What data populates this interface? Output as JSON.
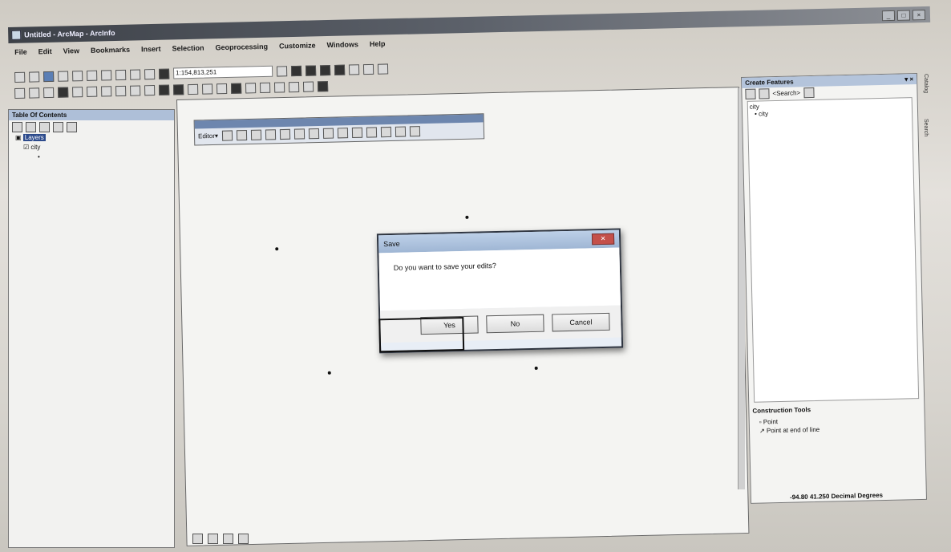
{
  "window": {
    "title": "Untitled - ArcMap - ArcInfo",
    "controls": [
      "_",
      "□",
      "×"
    ]
  },
  "menu": {
    "items": [
      "File",
      "Edit",
      "View",
      "Bookmarks",
      "Insert",
      "Selection",
      "Geoprocessing",
      "Customize",
      "Windows",
      "Help"
    ]
  },
  "toolbar": {
    "scale_value": "1:154,813,251"
  },
  "toc": {
    "title": "Table Of Contents",
    "layers_label": "Layers",
    "layer_item": "city"
  },
  "editor_toolbar": {
    "title": "Editor",
    "menu_label": "Editor▾"
  },
  "dialog": {
    "title": "Save",
    "message": "Do you want to save your edits?",
    "yes_label": "Yes",
    "no_label": "No",
    "cancel_label": "Cancel"
  },
  "create_features": {
    "title": "Create Features",
    "search_label": "<Search>",
    "template_group": "city",
    "template_item": "city"
  },
  "construction_tools": {
    "title": "Construction Tools",
    "items": [
      "Point",
      "Point at end of line"
    ]
  },
  "status": {
    "coords": "-94.80 41.250 Decimal Degrees"
  },
  "side_tabs": {
    "catalog": "Catalog",
    "search": "Search"
  }
}
